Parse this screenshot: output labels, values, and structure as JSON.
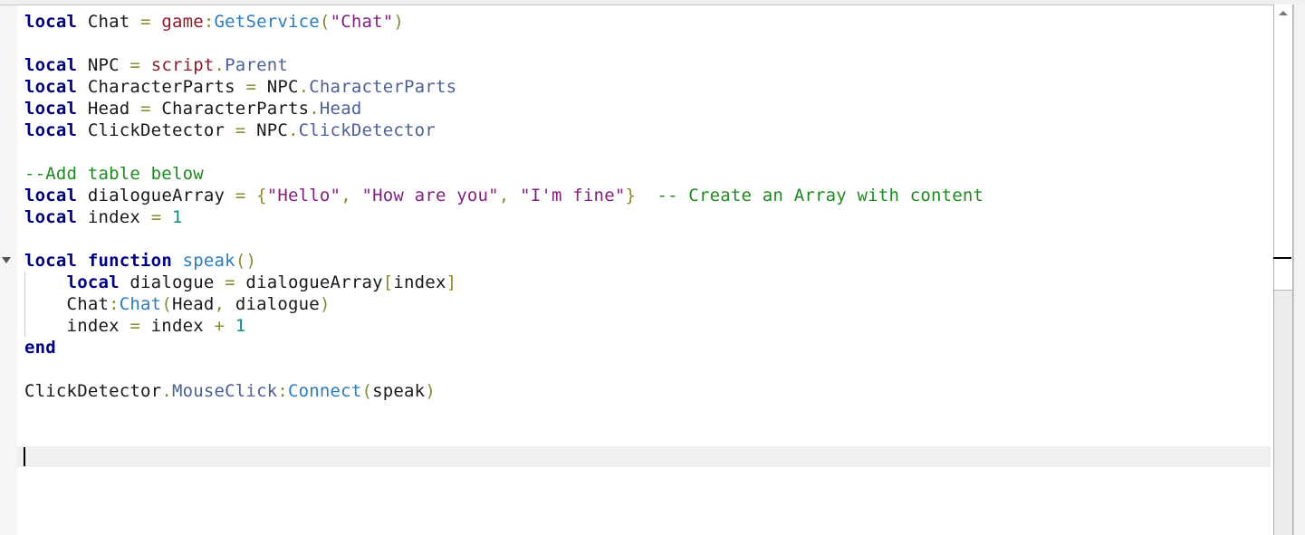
{
  "editor": {
    "lines": [
      [
        [
          "local",
          "k"
        ],
        [
          " Chat ",
          "i"
        ],
        [
          "=",
          "o"
        ],
        [
          " ",
          "i"
        ],
        [
          "game",
          "g"
        ],
        [
          ":",
          "o"
        ],
        [
          "GetService",
          "m"
        ],
        [
          "(",
          "o"
        ],
        [
          "\"Chat\"",
          "s"
        ],
        [
          ")",
          "o"
        ]
      ],
      [],
      [
        [
          "local",
          "k"
        ],
        [
          " NPC ",
          "i"
        ],
        [
          "=",
          "o"
        ],
        [
          " ",
          "i"
        ],
        [
          "script",
          "g"
        ],
        [
          ".",
          "o"
        ],
        [
          "Parent",
          "p"
        ]
      ],
      [
        [
          "local",
          "k"
        ],
        [
          " CharacterParts ",
          "i"
        ],
        [
          "=",
          "o"
        ],
        [
          " NPC",
          "i"
        ],
        [
          ".",
          "o"
        ],
        [
          "CharacterParts",
          "p"
        ]
      ],
      [
        [
          "local",
          "k"
        ],
        [
          " Head ",
          "i"
        ],
        [
          "=",
          "o"
        ],
        [
          " CharacterParts",
          "i"
        ],
        [
          ".",
          "o"
        ],
        [
          "Head",
          "p"
        ]
      ],
      [
        [
          "local",
          "k"
        ],
        [
          " ClickDetector ",
          "i"
        ],
        [
          "=",
          "o"
        ],
        [
          " NPC",
          "i"
        ],
        [
          ".",
          "o"
        ],
        [
          "ClickDetector",
          "p"
        ]
      ],
      [],
      [
        [
          "--Add table below",
          "c"
        ]
      ],
      [
        [
          "local",
          "k"
        ],
        [
          " dialogueArray ",
          "i"
        ],
        [
          "=",
          "o"
        ],
        [
          " ",
          "i"
        ],
        [
          "{",
          "o"
        ],
        [
          "\"Hello\"",
          "s"
        ],
        [
          ", ",
          "o"
        ],
        [
          "\"How are you\"",
          "s"
        ],
        [
          ", ",
          "o"
        ],
        [
          "\"I'm fine\"",
          "s"
        ],
        [
          "}",
          "o"
        ],
        [
          "  ",
          "i"
        ],
        [
          "-- Create an Array with content",
          "c"
        ]
      ],
      [
        [
          "local",
          "k"
        ],
        [
          " index ",
          "i"
        ],
        [
          "=",
          "o"
        ],
        [
          " ",
          "i"
        ],
        [
          "1",
          "n"
        ]
      ],
      [],
      [
        [
          "local",
          "k"
        ],
        [
          " ",
          "i"
        ],
        [
          "function",
          "k"
        ],
        [
          " ",
          "i"
        ],
        [
          "speak",
          "m"
        ],
        [
          "()",
          "o"
        ]
      ],
      [
        [
          "    ",
          "i"
        ],
        [
          "local",
          "k"
        ],
        [
          " dialogue ",
          "i"
        ],
        [
          "=",
          "o"
        ],
        [
          " dialogueArray",
          "i"
        ],
        [
          "[",
          "o"
        ],
        [
          "index",
          "i"
        ],
        [
          "]",
          "o"
        ]
      ],
      [
        [
          "    Chat",
          "i"
        ],
        [
          ":",
          "o"
        ],
        [
          "Chat",
          "m"
        ],
        [
          "(",
          "o"
        ],
        [
          "Head",
          "i"
        ],
        [
          ", ",
          "o"
        ],
        [
          "dialogue",
          "i"
        ],
        [
          ")",
          "o"
        ]
      ],
      [
        [
          "    index ",
          "i"
        ],
        [
          "=",
          "o"
        ],
        [
          " index ",
          "i"
        ],
        [
          "+",
          "o"
        ],
        [
          " ",
          "i"
        ],
        [
          "1",
          "n"
        ]
      ],
      [
        [
          "end",
          "k"
        ]
      ],
      [],
      [
        [
          "ClickDetector",
          "i"
        ],
        [
          ".",
          "o"
        ],
        [
          "MouseClick",
          "p"
        ],
        [
          ":",
          "o"
        ],
        [
          "Connect",
          "m"
        ],
        [
          "(",
          "o"
        ],
        [
          "speak",
          "i"
        ],
        [
          ")",
          "o"
        ]
      ],
      [],
      [],
      []
    ],
    "current_line": 21
  }
}
